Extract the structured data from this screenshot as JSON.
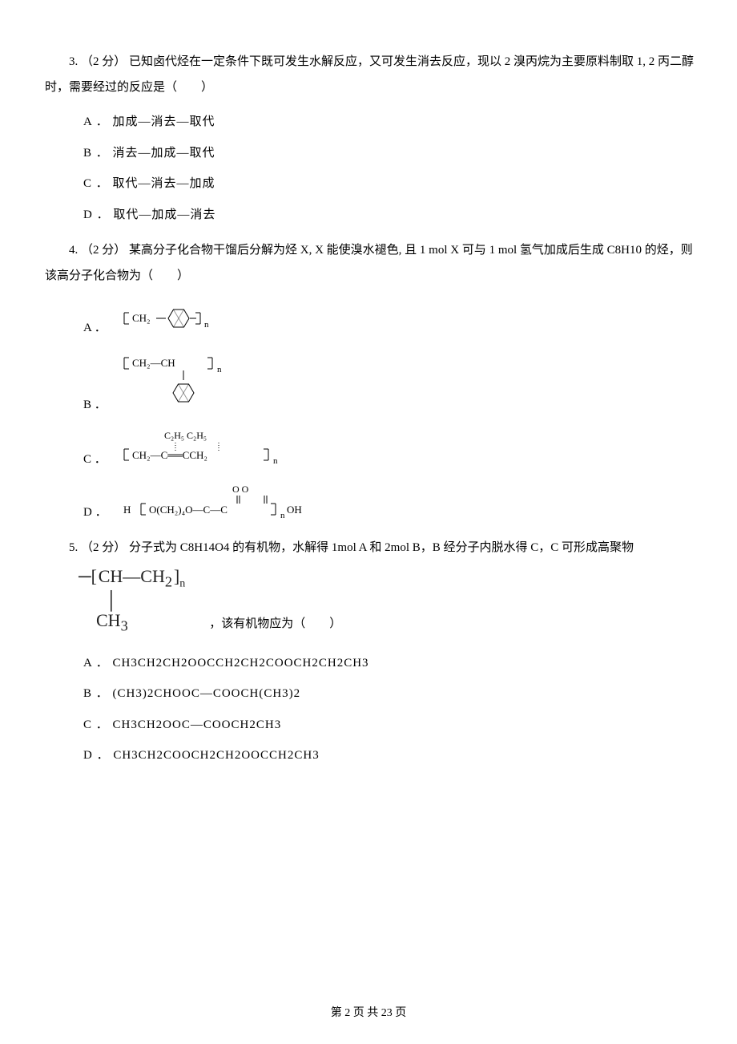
{
  "q3": {
    "stem": "3.  （2 分）  已知卤代烃在一定条件下既可发生水解反应，又可发生消去反应，现以 2 溴丙烷为主要原料制取 1, 2 丙二醇时，需要经过的反应是（　　）",
    "opts": {
      "A": "A ．  加成—消去—取代",
      "B": "B ．  消去—加成—取代",
      "C": "C ．  取代—消去—加成",
      "D": "D ．  取代—加成—消去"
    }
  },
  "q4": {
    "stem": "4.  （2 分）  某高分子化合物干馏后分解为烃 X, X 能使溴水褪色, 且 1 mol X 可与 1 mol 氢气加成后生成 C8H10 的烃，则该高分子化合物为（　　）",
    "opts": {
      "A": "A ．",
      "B": "B ．",
      "C": "C ．",
      "D": "D ．"
    }
  },
  "q5": {
    "stem": "5.  （2 分）  分子式为 C8H14O4 的有机物，水解得 1mol A 和 2mol B，B 经分子内脱水得 C，C 可形成高聚物",
    "trail": "，该有机物应为（　　）",
    "opts": {
      "A": "A ．  CH3CH2CH2OOCCH2CH2COOCH2CH2CH3",
      "B": "B ．  (CH3)2CHOOC—COOCH(CH3)2",
      "C": "C ．  CH3CH2OOC—COOCH2CH3",
      "D": "D ．  CH3CH2COOCH2CH2OOCCH2CH3"
    }
  },
  "footer": "第 2 页 共 23 页"
}
